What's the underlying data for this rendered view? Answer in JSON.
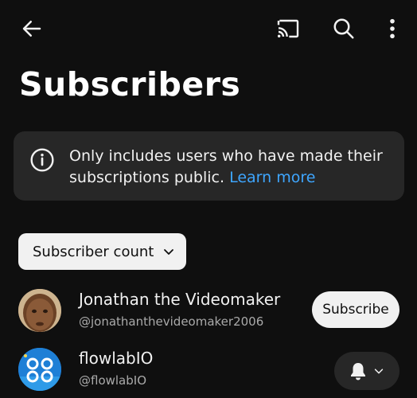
{
  "header": {
    "back_icon": "arrow-left-icon",
    "cast_icon": "cast-icon",
    "search_icon": "search-icon",
    "more_icon": "more-vertical-icon"
  },
  "page": {
    "title": "Subscribers"
  },
  "info": {
    "icon": "info-icon",
    "text": "Only includes users who have made their subscriptions public.",
    "link": "Learn more"
  },
  "sort": {
    "label": "Subscriber count",
    "icon": "chevron-down-icon"
  },
  "subscribers": [
    {
      "name": "Jonathan the Videomaker",
      "handle": "@jonathanthevideomaker2006",
      "action": "Subscribe"
    },
    {
      "name": "flowlabIO",
      "handle": "@flowlabIO",
      "action_icon": "bell-icon"
    }
  ],
  "colors": {
    "background": "#0f0f0f",
    "card": "#272727",
    "link": "#3ea6ff",
    "text": "#f1f1f1",
    "secondary_text": "#aaaaaa"
  }
}
